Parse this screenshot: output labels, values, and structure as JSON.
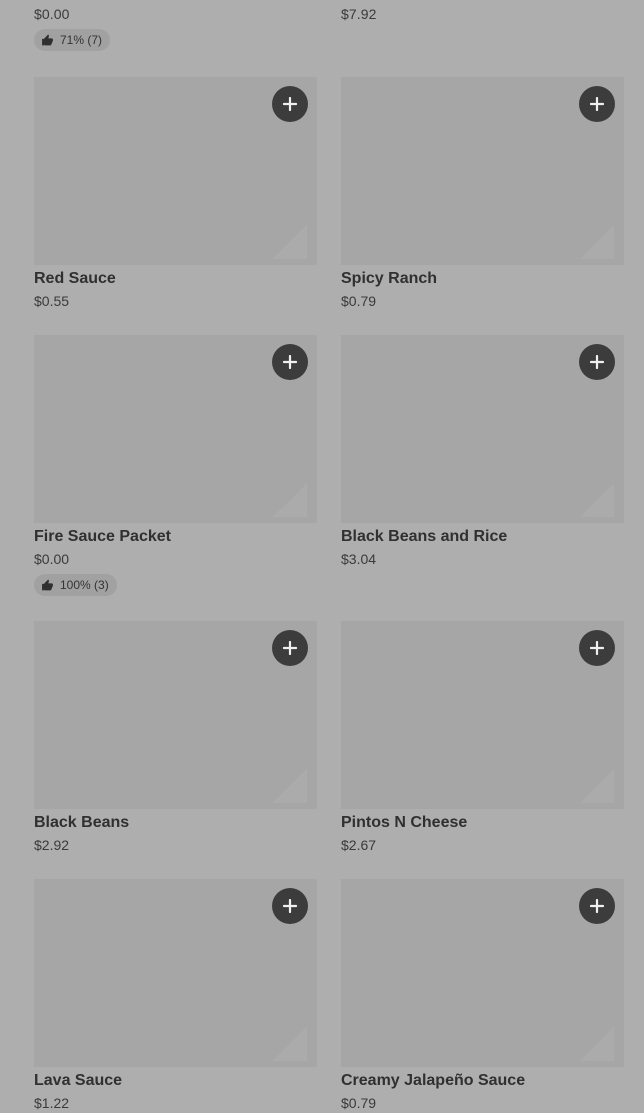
{
  "top_row": {
    "left": {
      "price": "$0.00",
      "rating": "71% (7)"
    },
    "right": {
      "price": "$7.92"
    }
  },
  "items": [
    {
      "name": "Red Sauce",
      "price": "$0.55"
    },
    {
      "name": "Spicy Ranch",
      "price": "$0.79"
    },
    {
      "name": "Fire Sauce Packet",
      "price": "$0.00",
      "rating": "100% (3)"
    },
    {
      "name": "Black Beans and Rice",
      "price": "$3.04"
    },
    {
      "name": "Black Beans",
      "price": "$2.92"
    },
    {
      "name": "Pintos N Cheese",
      "price": "$2.67"
    },
    {
      "name": "Lava Sauce",
      "price": "$1.22"
    },
    {
      "name": "Creamy Jalapeño Sauce",
      "price": "$0.79"
    }
  ],
  "icons": {
    "add": "plus-icon",
    "rating": "thumbs-up-icon"
  },
  "colors": {
    "background": "#aeaeae",
    "image_placeholder": "#a6a6a6",
    "add_button": "#3c3c3c",
    "rating_pill": "#a1a1a1"
  }
}
